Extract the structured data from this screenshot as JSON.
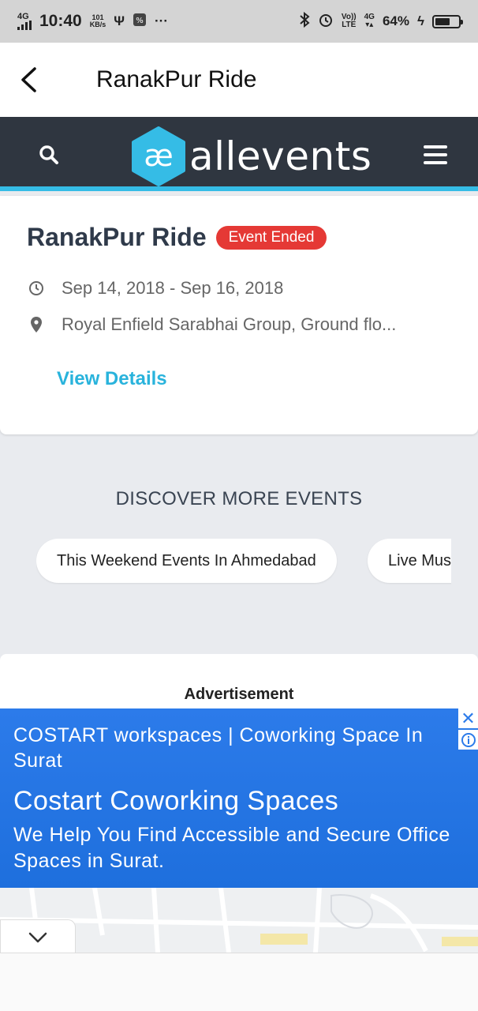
{
  "status_bar": {
    "network": "4G",
    "time": "10:40",
    "speed_value": "101",
    "speed_unit": "KB/s",
    "more": "···",
    "volte": "Vo))",
    "lte": "LTE",
    "net2": "4G",
    "battery": "64%",
    "battery_level": 0.64
  },
  "title_bar": {
    "title": "RanakPur Ride"
  },
  "header": {
    "brand": "allevents",
    "logo_mark": "æ"
  },
  "event": {
    "name": "RanakPur Ride",
    "badge": "Event Ended",
    "dates": "Sep 14, 2018 - Sep 16, 2018",
    "location": "Royal Enfield Sarabhai Group, Ground flo...",
    "view_details": "View Details"
  },
  "discover": {
    "title": "DISCOVER MORE EVENTS",
    "chips": [
      "This Weekend Events In Ahmedabad",
      "Live Music"
    ]
  },
  "ad": {
    "label": "Advertisement",
    "line1": "COSTART workspaces | Coworking Space In Surat",
    "headline": "Costart Coworking Spaces",
    "description": "We Help You Find Accessible and Secure Office Spaces in Surat.",
    "close": "✕",
    "accent": "#2c7bea"
  },
  "colors": {
    "brand_header": "#2f3640",
    "accent": "#35bce6",
    "badge": "#e53935",
    "link": "#29b3dc"
  }
}
